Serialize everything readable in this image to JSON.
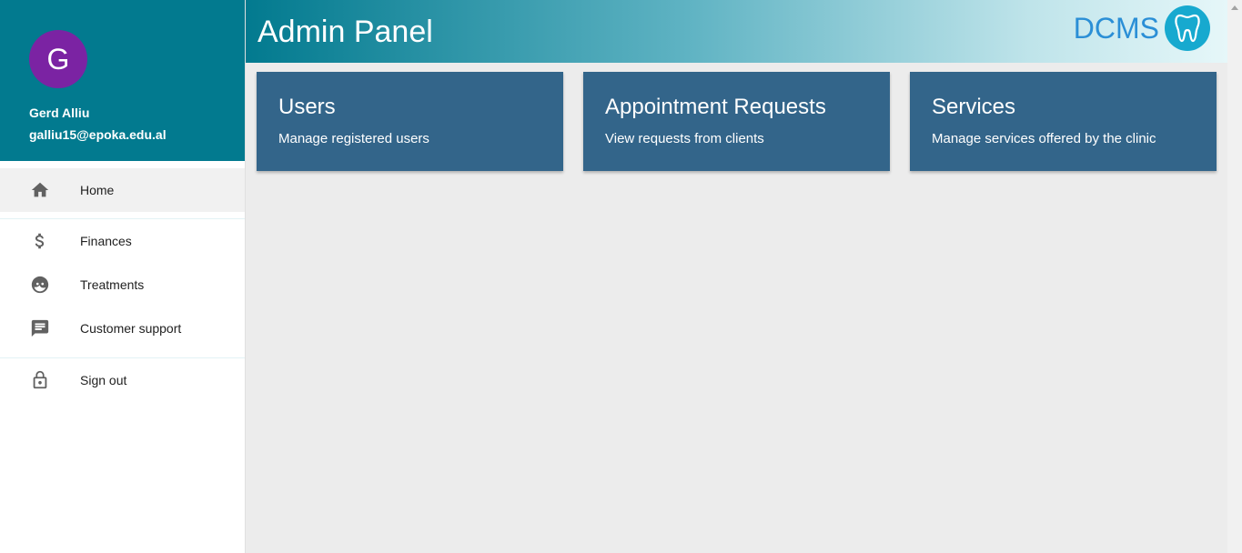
{
  "user": {
    "initial": "G",
    "name": "Gerd Alliu",
    "email": "galliu15@epoka.edu.al",
    "avatar_color": "#7b23a3"
  },
  "nav": {
    "items": [
      {
        "label": "Home",
        "icon": "home-icon",
        "active": true
      },
      {
        "label": "Finances",
        "icon": "dollar-icon"
      },
      {
        "label": "Treatments",
        "icon": "face-icon"
      },
      {
        "label": "Customer support",
        "icon": "message-icon"
      },
      {
        "label": "Sign out",
        "icon": "lock-icon"
      }
    ]
  },
  "header": {
    "title": "Admin Panel",
    "brand": "DCMS",
    "brand_logo": "tooth-icon"
  },
  "cards": [
    {
      "title": "Users",
      "description": "Manage registered users"
    },
    {
      "title": "Appointment Requests",
      "description": "View requests from clients"
    },
    {
      "title": "Services",
      "description": "Manage services offered by the clinic"
    }
  ],
  "colors": {
    "primary": "#027a8f",
    "card": "#33658a",
    "brand_text": "#2b8fd6",
    "brand_logo": "#17a9cf"
  }
}
